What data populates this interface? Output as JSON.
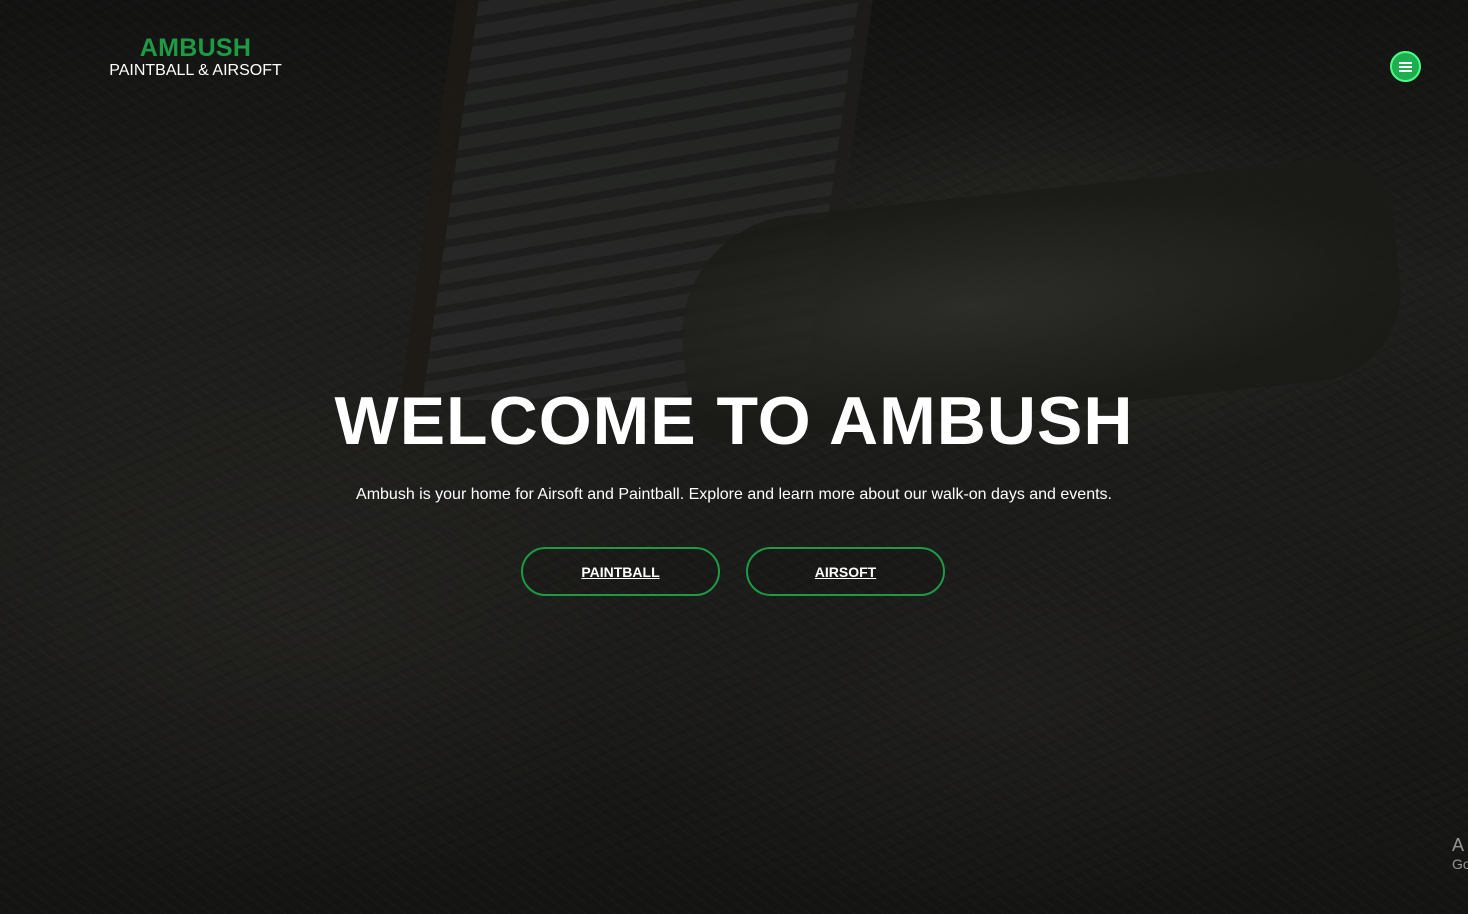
{
  "brand": {
    "name": "AMBUSH",
    "tagline": "PAINTBALL & AIRSOFT",
    "accent_color": "#1f9a44"
  },
  "nav": {
    "menu_icon": "hamburger-menu-icon"
  },
  "hero": {
    "title": "WELCOME TO AMBUSH",
    "subtitle": "Ambush is your home for Airsoft and Paintball. Explore and learn more about our walk-on days and events.",
    "buttons": [
      {
        "label": "PAINTBALL"
      },
      {
        "label": "AIRSOFT"
      }
    ]
  },
  "corner_overlay": {
    "line1": "A",
    "line2": "Go"
  }
}
